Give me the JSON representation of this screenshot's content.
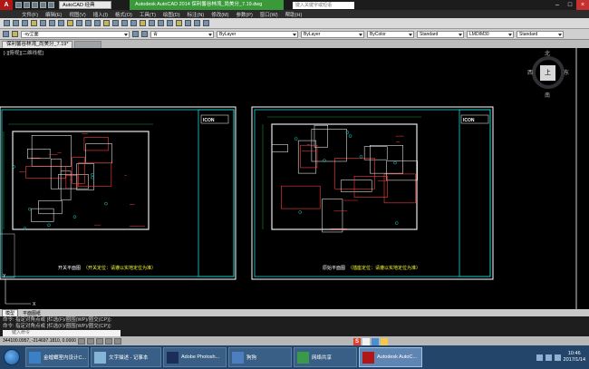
{
  "titlebar": {
    "app_logo": "A",
    "workspace": "AutoCAD 经典",
    "title": "Autodesk AutoCAD 2014   保利馨谷林湾_尚美分_7.19.dwg",
    "search_placeholder": "键入关键字或短语"
  },
  "menu": [
    {
      "label": "文件(F)"
    },
    {
      "label": "编辑(E)"
    },
    {
      "label": "视图(V)"
    },
    {
      "label": "插入(I)"
    },
    {
      "label": "格式(O)"
    },
    {
      "label": "工具(T)"
    },
    {
      "label": "绘图(D)"
    },
    {
      "label": "标注(N)"
    },
    {
      "label": "修改(M)"
    },
    {
      "label": "参数(P)"
    },
    {
      "label": "窗口(W)"
    },
    {
      "label": "帮助(H)"
    }
  ],
  "properties": {
    "view_label": "-xy立面",
    "color": "青",
    "linetype": "ByLayer",
    "lineweight": "ByLayer",
    "plotstyle": "ByColor",
    "text_style": "Standard",
    "dim_style": "LMDIM30",
    "table_style": "Standard"
  },
  "doc_tab": "保利馨谷林湾_尚美分_7.19*",
  "viewport_label": "[-][俯视][二维线框]",
  "viewcube": {
    "face": "上",
    "north": "北",
    "south": "南",
    "east": "东",
    "west": "西"
  },
  "sheets": [
    {
      "title": "开关平面图",
      "note": "（开关定位：请遵以实地定位为准）"
    },
    {
      "title": "原始平面图",
      "note": "（插座定位：请遵以实地定位为准）"
    }
  ],
  "layout_tabs": [
    "模型",
    "平面图纸"
  ],
  "command": {
    "line1": "命令: 指定对角点或 [栏选(F)/圈围(WP)/圈交(CP)]:",
    "line2": "命令: 指定对角点或 [栏选(F)/圈围(WP)/圈交(CP)]:",
    "input_placeholder": "键入命令"
  },
  "status": {
    "coords": "344100.0957, -214697.1810, 0.0000"
  },
  "taskbar": [
    {
      "label": "金螳螂室内设计C...",
      "color": "#3b7fc7"
    },
    {
      "label": "文字描述 - 记事本",
      "color": "#86b4d8"
    },
    {
      "label": "Adobe Photosh...",
      "color": "#1b2e5a"
    },
    {
      "label": "狗狗",
      "color": "#4d7fc0"
    },
    {
      "label": "网络共享",
      "color": "#3a9a4a"
    },
    {
      "label": "Autodesk AutoC...",
      "color": "#b01818"
    }
  ],
  "clock": {
    "time": "10:46",
    "date": "2017/1/14"
  }
}
